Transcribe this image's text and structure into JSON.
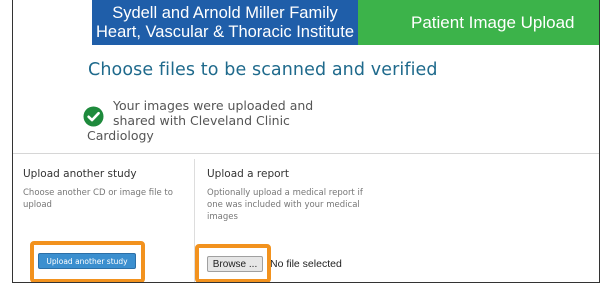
{
  "banner": {
    "institute_line1": "Sydell and Arnold Miller Family",
    "institute_line2": "Heart, Vascular & Thoracic Institute",
    "app_title": "Patient Image Upload",
    "colors": {
      "institute_bg": "#1f5ea9",
      "app_bg": "#3cb34a"
    }
  },
  "main": {
    "title": "Choose files to be scanned and verified",
    "success": {
      "icon": "check-circle-icon",
      "line1": "Your images were uploaded and",
      "line2": "shared with Cleveland Clinic",
      "line3": "Cardiology",
      "icon_color": "#1e8a3c"
    }
  },
  "upload_study": {
    "heading": "Upload another study",
    "description_line1": "Choose another CD or image file to",
    "description_line2": "upload",
    "button_label": "Upload another study"
  },
  "upload_report": {
    "heading": "Upload a report",
    "description_line1": "Optionally upload a medical report if",
    "description_line2": "one was included with your medical",
    "description_line3": "images",
    "browse_label": "Browse ...",
    "file_status": "No file selected"
  },
  "highlight_color": "#f2921e"
}
